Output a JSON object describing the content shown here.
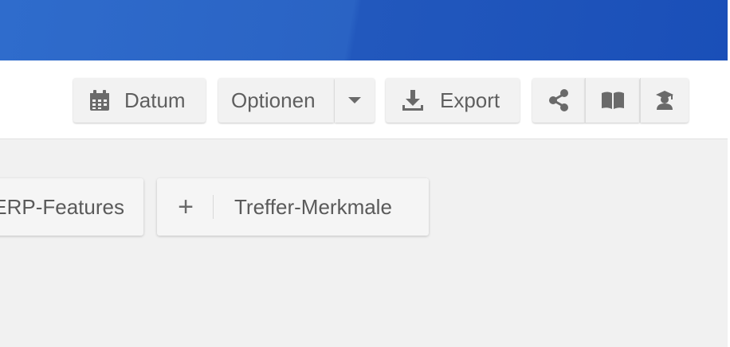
{
  "colors": {
    "header_blue": "#2a63c4",
    "button_bg": "#f2f2f2",
    "content_bg": "#f1f1f1",
    "text": "#5f5f5f"
  },
  "toolbar": {
    "datum": {
      "label": "Datum",
      "icon": "calendar-icon"
    },
    "optionen": {
      "label": "Optionen",
      "dropdown_icon": "caret-down-icon"
    },
    "export": {
      "label": "Export",
      "icon": "download-icon"
    },
    "share": {
      "icon": "share-icon"
    },
    "book": {
      "icon": "book-icon"
    },
    "scholar": {
      "icon": "scholar-icon"
    }
  },
  "chips": {
    "serp_features": {
      "label": "ERP-Features"
    },
    "treffer_merkmale": {
      "label": "Treffer-Merkmale",
      "icon": "plus-icon",
      "plus": "+"
    }
  }
}
